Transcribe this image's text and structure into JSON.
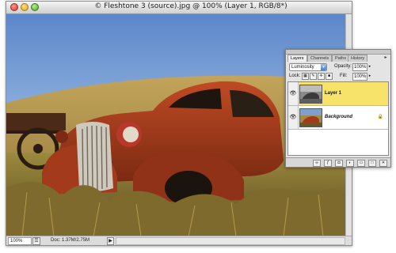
{
  "document": {
    "title": "© Fleshtone 3 (source).jpg @ 100% (Layer 1, RGB/8*)",
    "zoom": "100%",
    "doc_info": "Doc: 1.37M/2.75M",
    "arrow": "▶"
  },
  "layers_panel": {
    "tabs": [
      "Layers",
      "Channels",
      "Paths",
      "History"
    ],
    "blend_mode": "Luminosity",
    "opacity_label": "Opacity:",
    "opacity_value": "100%",
    "lock_label": "Lock:",
    "fill_label": "Fill:",
    "fill_value": "100%",
    "layers": [
      {
        "name": "Layer 1",
        "selected": true,
        "visible": true
      },
      {
        "name": "Background",
        "selected": false,
        "visible": true,
        "locked": true
      }
    ],
    "bottom_buttons": [
      "link-icon",
      "fx-icon",
      "mask-icon",
      "adjustment-icon",
      "folder-icon",
      "new-layer-icon",
      "trash-icon"
    ],
    "highlight_color": "#f7e26a"
  }
}
